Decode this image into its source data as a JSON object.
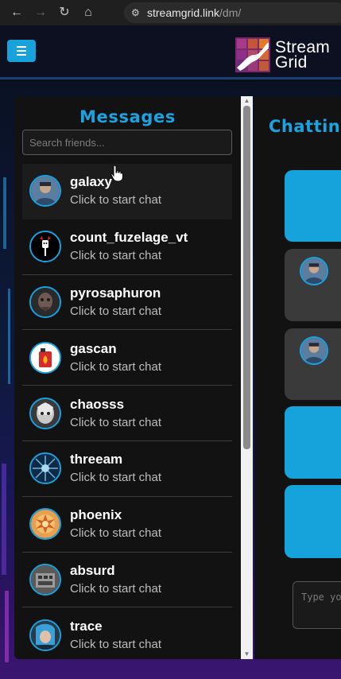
{
  "browser": {
    "url_host": "streamgrid.link",
    "url_path": "/dm/"
  },
  "site": {
    "logo_line1": "Stream",
    "logo_line2": "Grid",
    "accent": "#1aa3e0"
  },
  "sidebar": {
    "title": "Messages",
    "search_placeholder": "Search friends...",
    "friends": [
      {
        "name": "galaxy",
        "status": "Click to start chat",
        "avatar": "galaxy-avatar"
      },
      {
        "name": "count_fuzelage_vt",
        "status": "Click to start chat",
        "avatar": "count-avatar"
      },
      {
        "name": "pyrosaphuron",
        "status": "Click to start chat",
        "avatar": "pyrosaphuron-avatar"
      },
      {
        "name": "gascan",
        "status": "Click to start chat",
        "avatar": "gascan-avatar"
      },
      {
        "name": "chaosss",
        "status": "Click to start chat",
        "avatar": "chaosss-avatar"
      },
      {
        "name": "threeam",
        "status": "Click to start chat",
        "avatar": "threeam-avatar"
      },
      {
        "name": "phoenix",
        "status": "Click to start chat",
        "avatar": "phoenix-avatar"
      },
      {
        "name": "absurd",
        "status": "Click to start chat",
        "avatar": "absurd-avatar"
      },
      {
        "name": "trace",
        "status": "Click to start chat",
        "avatar": "trace-avatar"
      }
    ]
  },
  "chat": {
    "title": "Chatting",
    "input_placeholder": "Type yo"
  }
}
